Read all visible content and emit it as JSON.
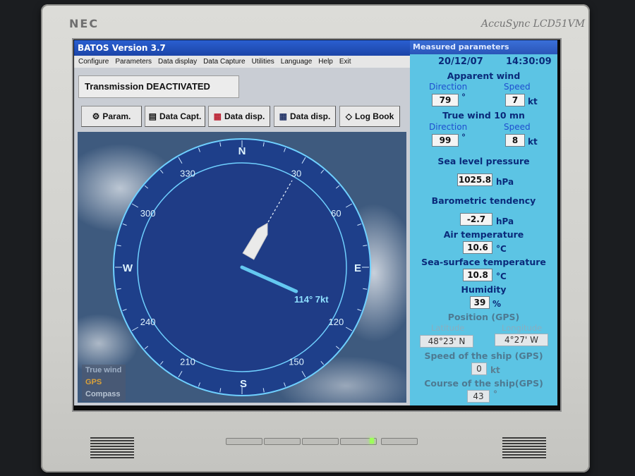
{
  "monitor": {
    "brand": "NEC",
    "model": "AccuSync LCD51VM"
  },
  "app": {
    "title": "BATOS Version 3.7",
    "menu": [
      "Configure",
      "Parameters",
      "Data display",
      "Data Capture",
      "Utilities",
      "Language",
      "Help",
      "Exit"
    ],
    "status": "Transmission DEACTIVATED",
    "toolbar": [
      {
        "label": "Param.",
        "icon": "parameters-icon"
      },
      {
        "label": "Data Capt.",
        "icon": "data-capture-icon"
      },
      {
        "label": "Data disp.",
        "icon": "chart-display-icon"
      },
      {
        "label": "Data disp.",
        "icon": "table-display-icon"
      },
      {
        "label": "Log Book",
        "icon": "logbook-icon"
      }
    ],
    "compass": {
      "cardinals": {
        "n": "N",
        "e": "E",
        "s": "S",
        "w": "W"
      },
      "degrees": [
        "30",
        "60",
        "120",
        "150",
        "210",
        "240",
        "300",
        "330"
      ],
      "heading_deg": 30,
      "wind_dir_deg": 114,
      "wind_speed_kt": 7,
      "wind_label": "114° 7kt"
    },
    "legend": [
      {
        "label": "True wind",
        "color": "#9fb0c6"
      },
      {
        "label": "GPS",
        "color": "#d9a13a"
      },
      {
        "label": "Compass",
        "color": "#b7c4d3"
      }
    ]
  },
  "panel": {
    "title": "Measured parameters",
    "date": "20/12/07",
    "time": "14:30:09",
    "apparent_wind": {
      "heading": "Apparent wind",
      "direction_label": "Direction",
      "speed_label": "Speed",
      "direction": "79",
      "direction_unit": "°",
      "speed": "7",
      "speed_unit": "kt"
    },
    "true_wind": {
      "heading": "True wind 10 mn",
      "direction_label": "Direction",
      "speed_label": "Speed",
      "direction": "99",
      "direction_unit": "°",
      "speed": "8",
      "speed_unit": "kt"
    },
    "pressure": {
      "heading": "Sea level pressure",
      "value": "1025.8",
      "unit": "hPa"
    },
    "tendency": {
      "heading": "Barometric tendency",
      "value": "-2.7",
      "unit": "hPa"
    },
    "air_temp": {
      "heading": "Air temperature",
      "value": "10.6",
      "unit": "°C"
    },
    "sea_temp": {
      "heading": "Sea-surface temperature",
      "value": "10.8",
      "unit": "°C"
    },
    "humidity": {
      "heading": "Humidity",
      "value": "39",
      "unit": "%"
    },
    "position": {
      "heading": "Position (GPS)",
      "lat_label": "Latitude",
      "lon_label": "Longitude",
      "lat": "48°23' N",
      "lon": "4°27' W"
    },
    "speed": {
      "heading": "Speed of the ship (GPS)",
      "value": "0",
      "unit": "kt"
    },
    "course": {
      "heading": "Course of the ship(GPS)",
      "value": "43",
      "unit": "°"
    }
  }
}
